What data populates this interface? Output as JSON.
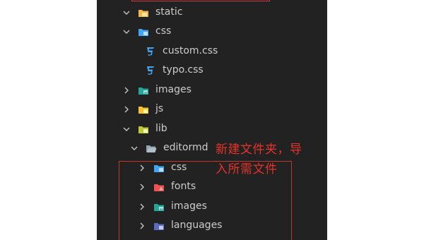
{
  "tree": {
    "items": [
      {
        "label": "static",
        "depth": 0,
        "expanded": true,
        "icon": "folder-static"
      },
      {
        "label": "css",
        "depth": 1,
        "expanded": true,
        "icon": "folder-css"
      },
      {
        "label": "custom.css",
        "depth": 2,
        "icon": "css-file"
      },
      {
        "label": "typo.css",
        "depth": 2,
        "icon": "css-file"
      },
      {
        "label": "images",
        "depth": 1,
        "expanded": false,
        "icon": "folder-images"
      },
      {
        "label": "js",
        "depth": 1,
        "expanded": false,
        "icon": "folder-js"
      },
      {
        "label": "lib",
        "depth": 1,
        "expanded": true,
        "icon": "folder-lib"
      },
      {
        "label": "editormd",
        "depth": 2,
        "expanded": true,
        "icon": "folder-plain"
      },
      {
        "label": "css",
        "depth": 3,
        "expanded": false,
        "icon": "folder-css"
      },
      {
        "label": "fonts",
        "depth": 3,
        "expanded": false,
        "icon": "folder-fonts"
      },
      {
        "label": "images",
        "depth": 3,
        "expanded": false,
        "icon": "folder-images"
      },
      {
        "label": "languages",
        "depth": 3,
        "expanded": false,
        "icon": "folder-languages"
      }
    ]
  },
  "annotation": {
    "line1": "新建文件夹，导",
    "line2": "入所需文件"
  },
  "colors": {
    "background": "#222222",
    "text": "#cccccc",
    "annotation": "#e8322a",
    "highlight_border": "#c0392b"
  }
}
